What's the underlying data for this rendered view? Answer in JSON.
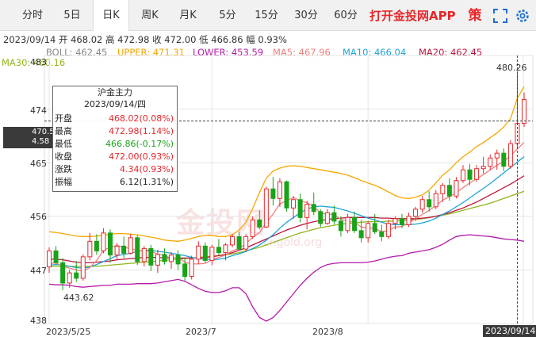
{
  "tabs": [
    {
      "label": "分时",
      "active": false
    },
    {
      "label": "5日",
      "active": false
    },
    {
      "label": "日K",
      "active": true
    },
    {
      "label": "周K",
      "active": false
    },
    {
      "label": "月K",
      "active": false
    },
    {
      "label": "5分",
      "active": false
    },
    {
      "label": "15分",
      "active": false
    },
    {
      "label": "30分",
      "active": false
    },
    {
      "label": "60分",
      "active": false
    }
  ],
  "brand": "打开金投网APP",
  "toolbar_icons": [
    "strategy-icon",
    "fullscreen-icon",
    "settings-icon"
  ],
  "strategy_label": "策",
  "info": {
    "date": "2023/09/14",
    "open_label": "开",
    "open": "468.02",
    "high_label": "高",
    "high": "472.98",
    "close_label": "收",
    "close": "472.00",
    "low_label": "低",
    "low": "466.86",
    "amp_label": "幅",
    "amp": "0.93%",
    "boll": "BOLL: 462.45",
    "upper": "UPPER: 471.31",
    "lower": "LOWER: 453.59",
    "ma5": "MA5: 467.96",
    "ma10": "MA10: 466.04",
    "ma20": "MA20: 462.45",
    "ma30": "MA30: 460.16"
  },
  "colors": {
    "up": "#e8262a",
    "down": "#19a319",
    "upper": "#f5a700",
    "boll_mid": "#e8262a",
    "lower": "#b31aa8",
    "ma5": "#f08080",
    "ma10": "#1fa3d8",
    "ma20": "#c0143c",
    "ma30": "#92b51b"
  },
  "tooltip": {
    "title": "沪金主力",
    "date": "2023/09/14/四",
    "rows": [
      {
        "label": "开盘",
        "value": "468.02(0.08%)",
        "color": "#e8262a"
      },
      {
        "label": "最高",
        "value": "472.98(1.14%)",
        "color": "#e8262a"
      },
      {
        "label": "最低",
        "value": "466.86(-0.17%)",
        "color": "#19a319"
      },
      {
        "label": "收盘",
        "value": "472.00(0.93%)",
        "color": "#e8262a"
      },
      {
        "label": "涨跌",
        "value": "4.34(0.93%)",
        "color": "#e8262a"
      },
      {
        "label": "振幅",
        "value": "6.12(1.31%)",
        "color": "#222222"
      }
    ]
  },
  "price_tag": {
    "line1": "470.5",
    "line2": "4.58"
  },
  "chart_data": {
    "type": "candlestick",
    "y_ticks": [
      "483",
      "474",
      "465",
      "456",
      "447",
      "438"
    ],
    "ylim": [
      438,
      483
    ],
    "x_ticks": [
      "2023/5/25",
      "2023/7",
      "2023/8",
      "2023/09/14"
    ],
    "annotations": {
      "max": "480.26",
      "min": "443.62"
    },
    "crosshair_price": 472.0,
    "candles_ohlc": [
      [
        447.5,
        450.8,
        446.5,
        450.2
      ],
      [
        450.2,
        451.0,
        447.8,
        448.2
      ],
      [
        448.2,
        449.0,
        443.6,
        444.8
      ],
      [
        444.8,
        447.0,
        444.0,
        446.5
      ],
      [
        446.5,
        448.5,
        445.0,
        445.6
      ],
      [
        445.6,
        449.6,
        445.2,
        449.2
      ],
      [
        449.2,
        453.2,
        448.6,
        451.8
      ],
      [
        451.8,
        453.0,
        449.5,
        450.2
      ],
      [
        450.2,
        454.0,
        449.8,
        453.2
      ],
      [
        453.2,
        453.8,
        448.2,
        449.5
      ],
      [
        449.5,
        451.5,
        448.8,
        451.0
      ],
      [
        451.0,
        452.6,
        449.0,
        449.8
      ],
      [
        449.8,
        453.0,
        449.6,
        452.4
      ],
      [
        452.4,
        452.8,
        447.8,
        448.4
      ],
      [
        448.4,
        451.0,
        447.6,
        450.6
      ],
      [
        450.6,
        451.2,
        446.8,
        447.8
      ],
      [
        447.8,
        450.4,
        446.5,
        449.6
      ],
      [
        449.6,
        450.6,
        447.9,
        448.4
      ],
      [
        448.4,
        450.0,
        447.2,
        449.5
      ],
      [
        449.5,
        450.3,
        447.0,
        448.0
      ],
      [
        448.0,
        449.0,
        445.2,
        445.9
      ],
      [
        445.9,
        449.4,
        445.4,
        448.8
      ],
      [
        448.8,
        451.8,
        448.0,
        451.0
      ],
      [
        451.0,
        451.6,
        448.2,
        448.6
      ],
      [
        448.6,
        451.2,
        447.8,
        450.8
      ],
      [
        450.8,
        452.2,
        449.5,
        449.9
      ],
      [
        449.9,
        451.5,
        448.6,
        451.2
      ],
      [
        451.2,
        453.0,
        450.8,
        452.6
      ],
      [
        452.6,
        453.4,
        450.2,
        450.5
      ],
      [
        450.5,
        453.0,
        450.1,
        452.6
      ],
      [
        452.6,
        456.0,
        452.2,
        455.4
      ],
      [
        455.4,
        457.0,
        453.8,
        454.2
      ],
      [
        454.2,
        461.0,
        454.0,
        460.6
      ],
      [
        460.6,
        462.6,
        457.8,
        459.0
      ],
      [
        459.0,
        462.4,
        457.6,
        461.8
      ],
      [
        461.8,
        462.0,
        456.8,
        457.4
      ],
      [
        457.4,
        459.4,
        455.6,
        458.8
      ],
      [
        458.8,
        459.8,
        455.0,
        455.8
      ],
      [
        455.8,
        458.6,
        453.8,
        458.0
      ],
      [
        458.0,
        460.0,
        456.2,
        456.8
      ],
      [
        456.8,
        457.2,
        454.2,
        454.8
      ],
      [
        454.8,
        457.2,
        454.6,
        456.6
      ],
      [
        456.6,
        457.8,
        454.6,
        455.2
      ],
      [
        455.2,
        456.0,
        452.6,
        453.6
      ],
      [
        453.6,
        456.4,
        453.2,
        455.8
      ],
      [
        455.8,
        456.8,
        453.2,
        453.6
      ],
      [
        453.6,
        455.4,
        451.6,
        452.4
      ],
      [
        452.4,
        455.2,
        451.6,
        454.8
      ],
      [
        454.8,
        456.4,
        453.0,
        453.4
      ],
      [
        453.4,
        454.6,
        451.8,
        452.6
      ],
      [
        452.6,
        455.4,
        452.2,
        454.8
      ],
      [
        454.8,
        456.0,
        453.8,
        455.6
      ],
      [
        455.6,
        456.4,
        454.0,
        454.6
      ],
      [
        454.6,
        456.6,
        454.2,
        456.0
      ],
      [
        456.0,
        457.6,
        455.2,
        457.2
      ],
      [
        457.2,
        459.4,
        456.6,
        458.8
      ],
      [
        458.8,
        460.2,
        456.8,
        457.6
      ],
      [
        457.6,
        460.4,
        457.2,
        459.8
      ],
      [
        459.8,
        461.6,
        458.4,
        461.2
      ],
      [
        461.2,
        462.4,
        458.6,
        459.4
      ],
      [
        459.4,
        462.6,
        459.0,
        462.0
      ],
      [
        462.0,
        464.6,
        461.6,
        463.8
      ],
      [
        463.8,
        464.8,
        461.2,
        462.2
      ],
      [
        462.2,
        464.6,
        461.8,
        464.0
      ],
      [
        464.0,
        466.0,
        463.2,
        464.4
      ],
      [
        464.4,
        466.4,
        463.8,
        465.8
      ],
      [
        465.8,
        467.2,
        463.8,
        466.6
      ],
      [
        466.6,
        467.4,
        463.6,
        464.4
      ],
      [
        464.4,
        468.8,
        464.0,
        468.2
      ],
      [
        468.2,
        480.26,
        467.4,
        471.6
      ],
      [
        471.6,
        476.8,
        471.0,
        475.6
      ]
    ],
    "series": {
      "boll_upper": [
        453.4,
        453.3,
        453.1,
        452.9,
        452.7,
        452.6,
        452.6,
        452.7,
        452.8,
        453.0,
        453.1,
        453.1,
        453.0,
        452.9,
        452.7,
        452.5,
        452.3,
        452.0,
        451.9,
        451.8,
        452.0,
        452.3,
        452.6,
        452.8,
        452.8,
        452.6,
        452.6,
        452.9,
        453.7,
        455.0,
        457.3,
        460.0,
        462.4,
        463.6,
        464.1,
        464.4,
        464.5,
        464.4,
        464.2,
        464.0,
        463.8,
        463.6,
        463.4,
        463.2,
        462.9,
        462.5,
        462.0,
        461.6,
        461.2,
        460.7,
        460.1,
        459.5,
        459.1,
        459.0,
        459.2,
        459.6,
        460.4,
        461.6,
        462.9,
        463.8,
        465.0,
        466.0,
        466.8,
        467.7,
        468.4,
        469.2,
        470.0,
        471.0,
        472.4,
        475.8,
        477.8
      ],
      "boll_mid": [
        449.0,
        449.0,
        448.8,
        448.6,
        448.4,
        448.3,
        448.4,
        448.5,
        448.6,
        448.7,
        448.8,
        448.8,
        448.8,
        448.8,
        448.7,
        448.6,
        448.5,
        448.5,
        448.5,
        448.6,
        448.6,
        448.7,
        448.9,
        449.1,
        449.4,
        449.8,
        450.3,
        450.9,
        451.5,
        452.2,
        452.9,
        453.5,
        453.9,
        454.2,
        454.5,
        454.8,
        455.0,
        455.2,
        455.4,
        455.5,
        455.5,
        455.4,
        455.4,
        455.4,
        455.4,
        455.4,
        455.2,
        455.0,
        454.8,
        454.6,
        454.5,
        454.6,
        454.8,
        455.0,
        455.4,
        455.9,
        456.4,
        457.1,
        457.8,
        458.6,
        459.3,
        460.0,
        460.7,
        461.4,
        462.0,
        462.6,
        463.2,
        463.8,
        464.5,
        465.4,
        466.2
      ],
      "boll_lower": [
        444.6,
        444.5,
        444.5,
        444.4,
        444.2,
        444.1,
        444.2,
        444.3,
        444.4,
        444.4,
        444.6,
        444.6,
        444.6,
        444.7,
        444.7,
        444.7,
        444.8,
        445.0,
        445.2,
        445.4,
        445.1,
        444.5,
        443.9,
        443.4,
        443.2,
        443.2,
        443.5,
        444.0,
        444.0,
        443.0,
        440.8,
        439.0,
        438.4,
        439.0,
        440.2,
        441.6,
        443.0,
        444.4,
        445.6,
        446.6,
        447.4,
        447.9,
        448.1,
        448.2,
        448.2,
        448.2,
        448.2,
        448.3,
        448.5,
        448.8,
        449.1,
        449.3,
        449.4,
        449.8,
        450.0,
        450.2,
        450.4,
        450.8,
        451.3,
        452.0,
        452.6,
        452.8,
        452.9,
        452.8,
        452.7,
        452.6,
        452.4,
        452.2,
        452.1,
        452.0,
        451.8
      ],
      "ma5": [
        448.0,
        448.2,
        447.6,
        447.3,
        447.0,
        446.8,
        447.4,
        448.6,
        450.3,
        450.8,
        451.1,
        450.8,
        450.6,
        450.2,
        450.2,
        450.2,
        449.6,
        449.5,
        448.9,
        449.1,
        448.3,
        448.0,
        448.0,
        448.1,
        448.7,
        449.1,
        449.5,
        450.2,
        450.6,
        451.4,
        452.5,
        453.3,
        454.9,
        456.4,
        458.1,
        458.6,
        459.2,
        458.6,
        458.3,
        457.6,
        456.6,
        456.3,
        456.3,
        455.5,
        455.2,
        455.0,
        454.2,
        454.0,
        454.0,
        453.4,
        453.6,
        454.2,
        454.3,
        454.9,
        455.6,
        456.3,
        457.0,
        457.8,
        458.7,
        459.3,
        460.0,
        460.8,
        461.6,
        462.3,
        463.0,
        463.8,
        464.6,
        465.2,
        466.2,
        467.3,
        468.4
      ],
      "ma10": [
        447.8,
        447.9,
        447.8,
        447.6,
        447.4,
        447.3,
        447.5,
        447.9,
        448.4,
        448.9,
        449.4,
        449.6,
        449.8,
        450.1,
        450.3,
        450.3,
        450.1,
        450.0,
        449.8,
        449.6,
        449.4,
        449.1,
        448.9,
        448.8,
        448.7,
        448.8,
        449.0,
        449.4,
        449.7,
        450.1,
        450.6,
        451.2,
        452.0,
        452.9,
        454.0,
        455.0,
        455.8,
        456.6,
        457.2,
        457.6,
        457.7,
        457.6,
        457.5,
        457.2,
        456.9,
        456.5,
        456.1,
        455.7,
        455.4,
        455.0,
        454.7,
        454.6,
        454.6,
        454.6,
        454.7,
        454.9,
        455.2,
        455.7,
        456.3,
        456.9,
        457.6,
        458.3,
        459.1,
        459.9,
        460.7,
        461.5,
        462.4,
        463.3,
        464.2,
        465.1,
        466.0
      ],
      "ma20": [
        448.8,
        448.8,
        448.7,
        448.5,
        448.3,
        448.2,
        448.2,
        448.3,
        448.4,
        448.5,
        448.7,
        448.8,
        448.9,
        449.0,
        449.1,
        449.1,
        449.1,
        449.0,
        449.0,
        449.0,
        449.0,
        449.0,
        449.0,
        449.1,
        449.2,
        449.4,
        449.6,
        449.9,
        450.3,
        450.7,
        451.2,
        451.7,
        452.2,
        452.7,
        453.2,
        453.7,
        454.1,
        454.5,
        454.8,
        455.1,
        455.3,
        455.5,
        455.6,
        455.7,
        455.8,
        455.8,
        455.8,
        455.8,
        455.8,
        455.7,
        455.7,
        455.6,
        455.6,
        455.6,
        455.6,
        455.7,
        455.8,
        456.0,
        456.3,
        456.6,
        457.0,
        457.4,
        457.9,
        458.4,
        459.0,
        459.6,
        460.2,
        460.8,
        461.4,
        462.1,
        462.8
      ],
      "ma30": [
        447.6,
        447.6,
        447.6,
        447.6,
        447.6,
        447.6,
        447.6,
        447.6,
        447.7,
        447.8,
        447.9,
        448.0,
        448.1,
        448.2,
        448.3,
        448.4,
        448.5,
        448.6,
        448.7,
        448.8,
        448.9,
        449.0,
        449.1,
        449.2,
        449.3,
        449.4,
        449.5,
        449.7,
        449.9,
        450.2,
        450.5,
        450.8,
        451.2,
        451.6,
        452.0,
        452.4,
        452.8,
        453.2,
        453.5,
        453.8,
        454.1,
        454.3,
        454.5,
        454.7,
        454.8,
        454.9,
        455.0,
        455.1,
        455.1,
        455.1,
        455.2,
        455.2,
        455.3,
        455.4,
        455.5,
        455.6,
        455.8,
        456.0,
        456.2,
        456.4,
        456.7,
        457.0,
        457.3,
        457.6,
        457.9,
        458.2,
        458.6,
        459.0,
        459.4,
        459.8,
        460.2
      ]
    }
  }
}
